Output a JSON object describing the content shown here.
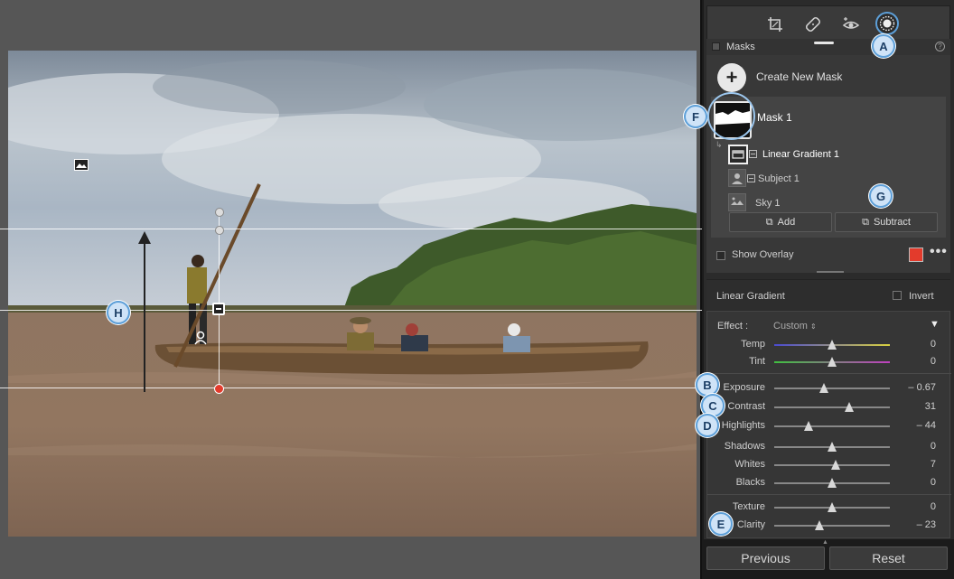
{
  "toolbar": {
    "tools": [
      {
        "icon": "crop-icon"
      },
      {
        "icon": "healing-icon"
      },
      {
        "icon": "red-eye-icon"
      },
      {
        "icon": "masking-icon",
        "active": true
      }
    ]
  },
  "masks_panel": {
    "title": "Masks",
    "create_label": "Create New Mask",
    "mask": {
      "name": "Mask 1",
      "components": [
        {
          "name": "Linear Gradient 1",
          "icon": "linear-gradient-icon",
          "selected": true
        },
        {
          "name": "Subject 1",
          "icon": "subject-icon",
          "selected": false
        },
        {
          "name": "Sky 1",
          "icon": "sky-icon",
          "selected": false
        }
      ]
    },
    "add_label": "Add",
    "subtract_label": "Subtract",
    "show_overlay_label": "Show Overlay",
    "show_overlay_checked": false,
    "overlay_color": "#e33b2c"
  },
  "adjustments": {
    "header_title": "Linear Gradient",
    "invert_label": "Invert",
    "invert_checked": false,
    "effect_label": "Effect :",
    "effect_value": "Custom",
    "sliders": [
      {
        "name": "temp",
        "label": "Temp",
        "value": "0",
        "pos": 0.5
      },
      {
        "name": "tint",
        "label": "Tint",
        "value": "0",
        "pos": 0.5
      },
      {
        "name": "exposure",
        "label": "Exposure",
        "value": "– 0.67",
        "pos": 0.43
      },
      {
        "name": "contrast",
        "label": "Contrast",
        "value": "31",
        "pos": 0.65
      },
      {
        "name": "highlights",
        "label": "Highlights",
        "value": "– 44",
        "pos": 0.3
      },
      {
        "name": "shadows",
        "label": "Shadows",
        "value": "0",
        "pos": 0.5
      },
      {
        "name": "whites",
        "label": "Whites",
        "value": "7",
        "pos": 0.53
      },
      {
        "name": "blacks",
        "label": "Blacks",
        "value": "0",
        "pos": 0.5
      },
      {
        "name": "texture",
        "label": "Texture",
        "value": "0",
        "pos": 0.5
      },
      {
        "name": "clarity",
        "label": "Clarity",
        "value": "– 23",
        "pos": 0.39
      }
    ]
  },
  "footer": {
    "previous_label": "Previous",
    "reset_label": "Reset"
  },
  "callouts": {
    "A": "A",
    "B": "B",
    "C": "C",
    "D": "D",
    "E": "E",
    "F": "F",
    "G": "G",
    "H": "H"
  },
  "colors": {
    "accent_callout": "#5d9fd8",
    "gradient_pin": "#e33b2c"
  }
}
